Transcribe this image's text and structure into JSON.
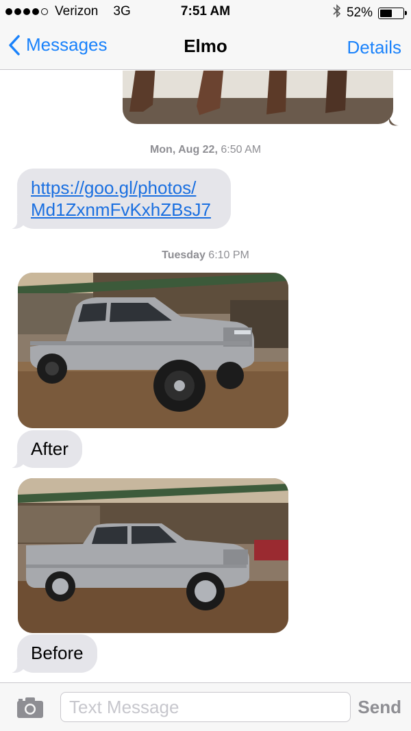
{
  "status_bar": {
    "carrier": "Verizon",
    "network": "3G",
    "time": "7:51 AM",
    "battery_percent": "52%",
    "battery_level": 0.52,
    "signal_bars_filled": 4,
    "icons": [
      "signal-dots-icon",
      "bluetooth-icon",
      "battery-icon"
    ]
  },
  "nav": {
    "back_label": "Messages",
    "title": "Elmo",
    "details_label": "Details"
  },
  "messages": {
    "timestamp1_day": "Mon, Aug 22,",
    "timestamp1_time": "6:50 AM",
    "link_line1": "https://goo.gl/photos/",
    "link_line2": "Md1ZxnmFvKxhZBsJ7",
    "timestamp2_day": "Tuesday",
    "timestamp2_time": "6:10 PM",
    "after_label": "After",
    "before_label": "Before"
  },
  "input": {
    "placeholder": "Text Message",
    "send_label": "Send"
  },
  "colors": {
    "accent": "#1a82fb",
    "bubble_gray": "#e5e5ea",
    "truck_silver": "#a7a9ad"
  }
}
